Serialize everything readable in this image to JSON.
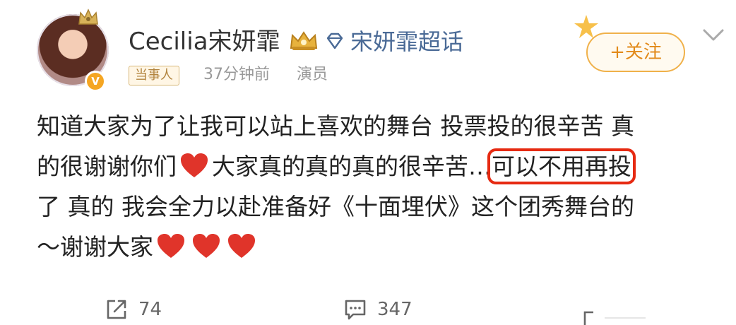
{
  "post": {
    "username": "Cecilia宋妍霏",
    "supertopic": "宋妍霏超话",
    "role_badge": "当事人",
    "time": "37分钟前",
    "profession": "演员",
    "follow_label": "+关注"
  },
  "content": {
    "line1": "知道大家为了让我可以站上喜欢的舞台 投票投的很辛苦 真",
    "line2_a": "的很谢谢你们",
    "line2_b": "大家真的真的真的很辛苦…",
    "line2_highlight": "可以不用再投",
    "line3": "了 真的  我会全力以赴准备好《十面埋伏》这个团秀舞台的",
    "line4": "～谢谢大家"
  },
  "actions": {
    "repost_count": "74",
    "comment_count": "347"
  },
  "icons": {
    "crown": "crown-icon",
    "diamond": "diamond-icon",
    "heart": "heart-icon",
    "repost": "repost-icon",
    "comment": "comment-icon",
    "chevron": "chevron-down-icon"
  },
  "colors": {
    "highlight_border": "#e62a12",
    "heart": "#e0342a",
    "follow_accent": "#e28a1a",
    "supertopic_link": "#4a6a96"
  }
}
